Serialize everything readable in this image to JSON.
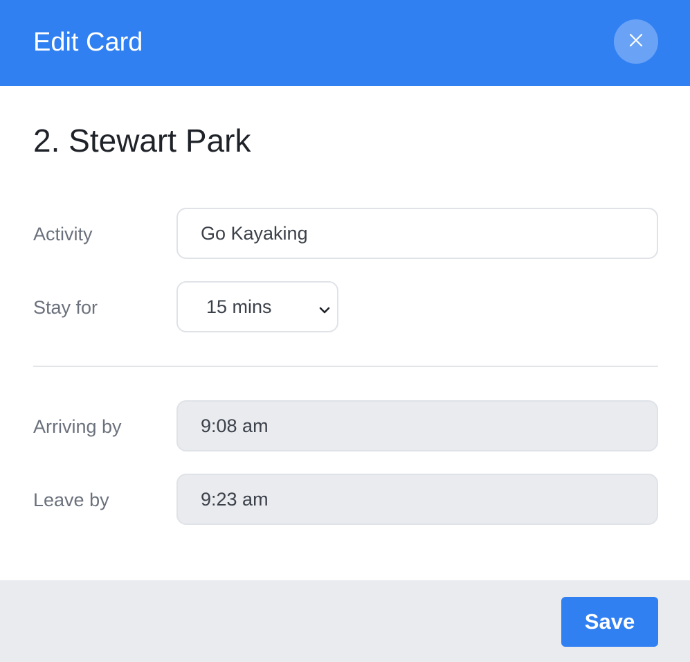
{
  "header": {
    "title": "Edit Card",
    "close_icon": "close-icon",
    "color": "#3180f2"
  },
  "card": {
    "title": "2. Stewart Park"
  },
  "form": {
    "activity": {
      "label": "Activity",
      "value": "Go Kayaking"
    },
    "stay_for": {
      "label": "Stay for",
      "value": "15 mins",
      "icon": "chevron-down-icon"
    },
    "arriving_by": {
      "label": "Arriving by",
      "value": "9:08 am"
    },
    "leave_by": {
      "label": "Leave by",
      "value": "9:23 am"
    }
  },
  "footer": {
    "save_label": "Save"
  }
}
